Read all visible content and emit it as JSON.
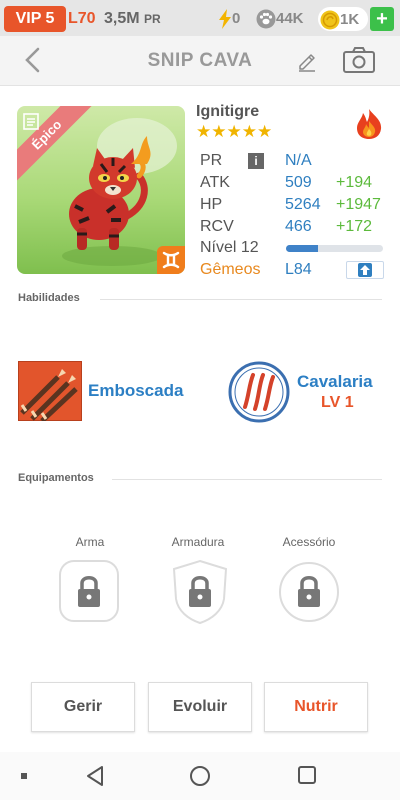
{
  "topbar": {
    "vip": "VIP 5",
    "level": "L70",
    "pr_amount": "3,5M",
    "pr_unit": "PR",
    "energy": "0",
    "paws": "44K",
    "coins": "1K",
    "plus": "+"
  },
  "header": {
    "title": "SNIP CAVA",
    "back_icon": "chevron-left-icon",
    "edit_icon": "pencil-icon",
    "camera_icon": "camera-icon"
  },
  "monster": {
    "name": "Ignitigre",
    "stars": "★★★★★",
    "rarity": "Épico",
    "element_icon": "fire-icon",
    "stats": {
      "pr_label": "PR",
      "pr_value": "N/A",
      "atk_label": "ATK",
      "atk_value": "509",
      "atk_bonus": "+194",
      "hp_label": "HP",
      "hp_value": "5264",
      "hp_bonus": "+1947",
      "rcv_label": "RCV",
      "rcv_value": "466",
      "rcv_bonus": "+172",
      "level_label": "Nível 12",
      "level_progress": 0.33,
      "sign_label": "Gêmeos",
      "sign_value": "L84"
    }
  },
  "sections": {
    "skills_title": "Habilidades",
    "equipment_title": "Equipamentos"
  },
  "skills": [
    {
      "name": "Emboscada",
      "level": ""
    },
    {
      "name": "Cavalaria",
      "level": "LV 1"
    }
  ],
  "equipment": [
    {
      "label": "Arma"
    },
    {
      "label": "Armadura"
    },
    {
      "label": "Acessório"
    }
  ],
  "actions": {
    "manage": "Gerir",
    "evolve": "Evoluir",
    "feed": "Nutrir"
  },
  "colors": {
    "accent_orange": "#e8552a",
    "value_blue": "#2f7fc0",
    "bonus_green": "#5cba3c",
    "star_gold": "#f0b400"
  }
}
